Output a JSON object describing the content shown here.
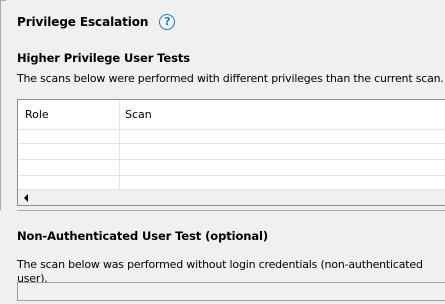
{
  "section": {
    "title": "Privilege Escalation",
    "help_icon": "question-mark-icon"
  },
  "higher_privilege": {
    "heading": "Higher Privilege User Tests",
    "description": "The scans below were performed with different privileges than the current scan.",
    "columns": [
      "Role",
      "Scan"
    ],
    "rows": []
  },
  "non_authenticated": {
    "heading": "Non-Authenticated User Test (optional)",
    "description": "The scan below was performed without login credentials (non-authenticated user).",
    "value": ""
  },
  "colors": {
    "background": "#f0f0f0",
    "grid_background": "#ffffff",
    "help_accent": "#2a74c4",
    "border": "#a9a9a9"
  }
}
